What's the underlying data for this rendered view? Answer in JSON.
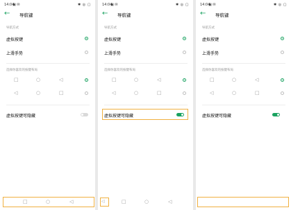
{
  "status_bar": {
    "time": "14:04",
    "icons_left": "▣ ✉",
    "icons_right": "✱ ◎ ▢"
  },
  "header": {
    "back_icon": "arrow-left-icon",
    "title": "导航键"
  },
  "nav_mode": {
    "section_label": "导航方式",
    "options": [
      {
        "label": "虚拟按键",
        "selected": true
      },
      {
        "label": "上滑手势",
        "selected": false
      }
    ]
  },
  "layout": {
    "section_label": "选择你喜欢的按键布局",
    "rows": [
      {
        "icons": [
          "□",
          "○",
          "◁"
        ],
        "selected": true
      },
      {
        "icons": [
          "◁",
          "○",
          "□"
        ],
        "selected": false
      }
    ]
  },
  "hide_toggle": {
    "label": "虚拟按键可隐藏",
    "panels": [
      {
        "on": false
      },
      {
        "on": true
      },
      {
        "on": true
      }
    ]
  },
  "bottom_nav": {
    "icons": [
      "□",
      "○",
      "◁"
    ]
  },
  "colors": {
    "accent": "#1aa260",
    "highlight": "#f0b040"
  }
}
